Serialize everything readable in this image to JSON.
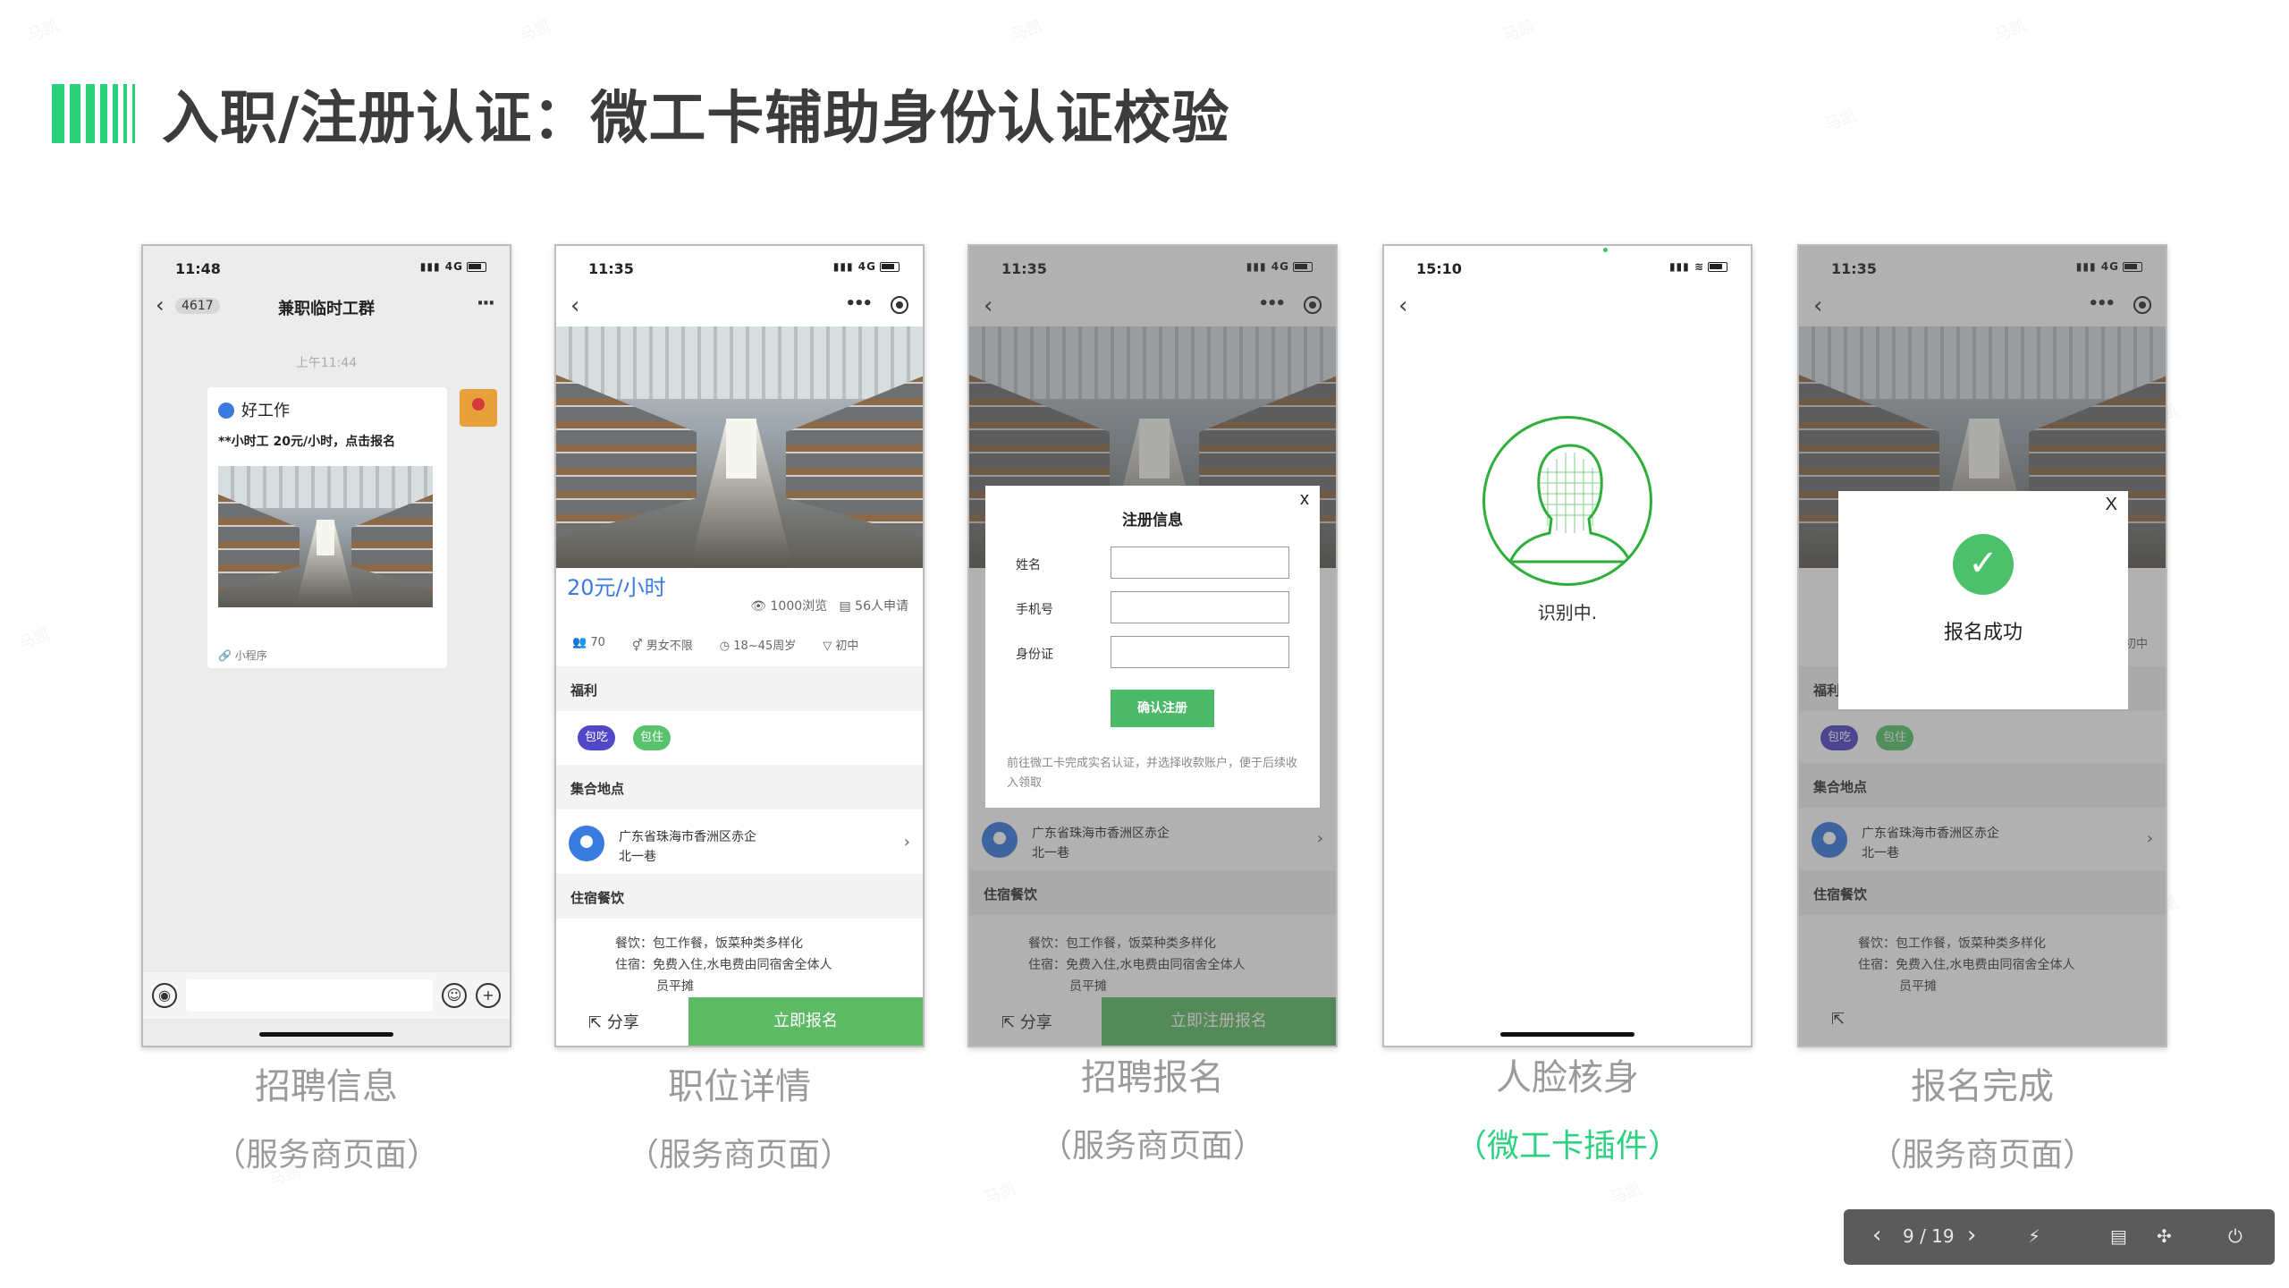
{
  "page": {
    "title": "入职/注册认证：微工卡辅助身份认证校验",
    "watermark": "马凯"
  },
  "phones": [
    {
      "status_time": "11:48",
      "signal": "4G",
      "chat": {
        "badge": "4617",
        "group_name": "兼职临时工群",
        "msg_time": "上午11:44",
        "card_brand": "好工作",
        "card_text": "**小时工 20元/小时，点击报名",
        "mini_program": "小程序"
      }
    },
    {
      "status_time": "11:35",
      "signal": "4G",
      "price": "20元/小时",
      "views": "1000浏览",
      "applicants": "56人申请",
      "tags": [
        "70",
        "男女不限",
        "18~45周岁",
        "初中"
      ],
      "welfare_title": "福利",
      "welfare_chips": [
        "包吃",
        "包住"
      ],
      "location_title": "集合地点",
      "address_line1": "广东省珠海市香洲区赤企",
      "address_line2": "北一巷",
      "lodging_title": "住宿餐饮",
      "food_line": "餐饮：包工作餐，饭菜种类多样化",
      "stay_line": "住宿：免费入住,水电费由同宿舍全体人",
      "stay_line2": "员平摊",
      "share": "分享",
      "apply": "立即报名"
    },
    {
      "status_time": "11:35",
      "signal": "4G",
      "modal_title": "注册信息",
      "close": "x",
      "fields": [
        "姓名",
        "手机号",
        "身份证"
      ],
      "confirm": "确认注册",
      "note": "前往微工卡完成实名认证，并选择收款账户，便于后续收入领取",
      "address_line1": "广东省珠海市香洲区赤企",
      "address_line2": "北一巷",
      "lodging_title": "住宿餐饮",
      "food_line": "餐饮：包工作餐，饭菜种类多样化",
      "stay_line": "住宿：免费入住,水电费由同宿舍全体人",
      "stay_line2": "员平摊",
      "share": "分享",
      "apply": "立即注册报名"
    },
    {
      "status_time": "15:10",
      "recognizing": "识别中."
    },
    {
      "status_time": "11:35",
      "signal": "4G",
      "close": "X",
      "success": "报名成功",
      "welfare_title": "福利",
      "welfare_chips": [
        "包吃",
        "包住"
      ],
      "location_title": "集合地点",
      "address_line1": "广东省珠海市香洲区赤企",
      "address_line2": "北一巷",
      "lodging_title": "住宿餐饮",
      "food_line": "餐饮：包工作餐，饭菜种类多样化",
      "stay_line": "住宿：免费入住,水电费由同宿舍全体人",
      "stay_line2": "员平摊",
      "edge_text": "初中"
    }
  ],
  "captions": [
    {
      "title": "招聘信息",
      "sub": "（服务商页面）"
    },
    {
      "title": "职位详情",
      "sub": "（服务商页面）"
    },
    {
      "title": "招聘报名",
      "sub": "（服务商页面）"
    },
    {
      "title": "人脸核身",
      "sub": "（微工卡插件）"
    },
    {
      "title": "报名完成",
      "sub": "（服务商页面）"
    }
  ],
  "controls": {
    "page_indicator": "9 / 19"
  },
  "colors": {
    "accent_green": "#2ed182",
    "title_text": "#3c3c3c",
    "button_green": "#5fba66",
    "link_blue": "#3a7be0",
    "chip_purple": "#5147c9"
  }
}
